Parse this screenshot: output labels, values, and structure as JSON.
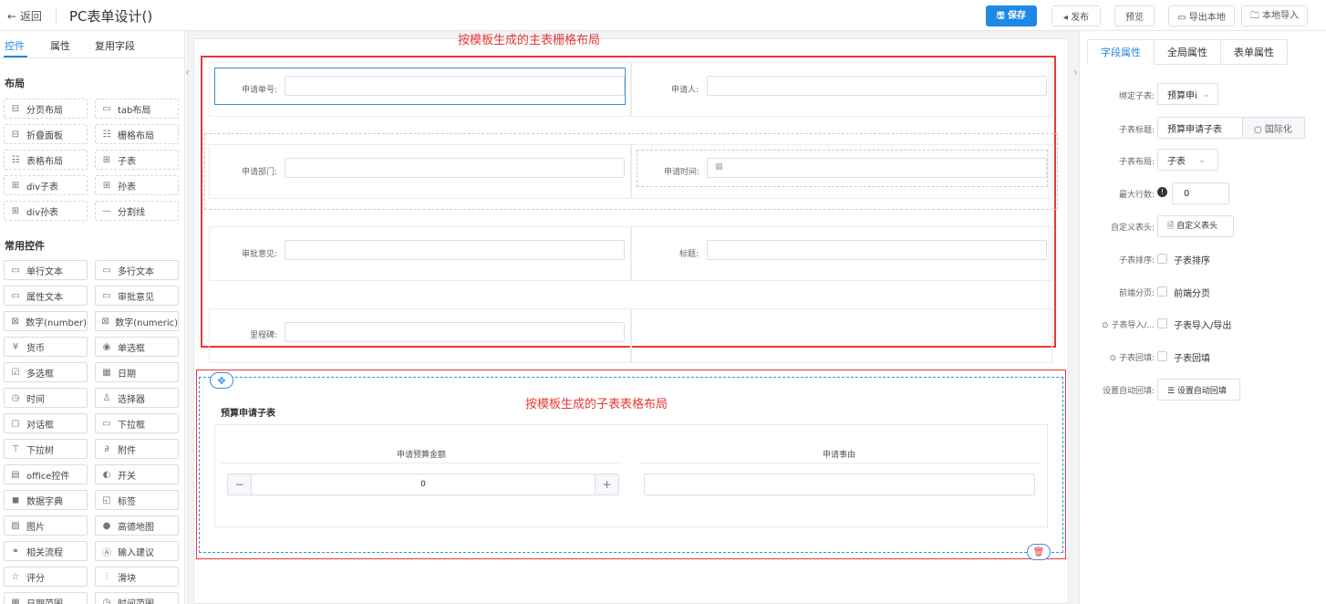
{
  "header": {
    "back_label": "← 返回",
    "title": "PC表单设计()",
    "buttons": {
      "save": "🖫 保存",
      "publish": "◂ 发布",
      "preview": "预览",
      "export": "▭ 导出本地",
      "import": "🗀 本地导入"
    }
  },
  "left_panel": {
    "tabs": [
      "控件",
      "属性",
      "复用字段"
    ],
    "layout_section": "布局",
    "layout_items": [
      {
        "icon": "⊟",
        "label": "分页布局"
      },
      {
        "icon": "▭",
        "label": "tab布局"
      },
      {
        "icon": "⊟",
        "label": "折叠面板"
      },
      {
        "icon": "☷",
        "label": "栅格布局"
      },
      {
        "icon": "☷",
        "label": "表格布局"
      },
      {
        "icon": "⊞",
        "label": "子表"
      },
      {
        "icon": "⊞",
        "label": "div子表"
      },
      {
        "icon": "⊞",
        "label": "孙表"
      },
      {
        "icon": "⊞",
        "label": "div孙表"
      },
      {
        "icon": "—",
        "label": "分割线"
      }
    ],
    "common_section": "常用控件",
    "common_items": [
      {
        "icon": "▭",
        "label": "单行文本"
      },
      {
        "icon": "▭",
        "label": "多行文本"
      },
      {
        "icon": "▭",
        "label": "属性文本"
      },
      {
        "icon": "▭",
        "label": "审批意见"
      },
      {
        "icon": "⊠",
        "label": "数字(number)"
      },
      {
        "icon": "⊠",
        "label": "数字(numeric)"
      },
      {
        "icon": "¥",
        "label": "货币"
      },
      {
        "icon": "◉",
        "label": "单选框"
      },
      {
        "icon": "☑",
        "label": "多选框"
      },
      {
        "icon": "▦",
        "label": "日期"
      },
      {
        "icon": "◷",
        "label": "时间"
      },
      {
        "icon": "♙",
        "label": "选择器"
      },
      {
        "icon": "▢",
        "label": "对话框"
      },
      {
        "icon": "▭",
        "label": "下拉框"
      },
      {
        "icon": "⊤",
        "label": "下拉树"
      },
      {
        "icon": "∂",
        "label": "附件"
      },
      {
        "icon": "▤",
        "label": "office控件"
      },
      {
        "icon": "◐",
        "label": "开关"
      },
      {
        "icon": "◼",
        "label": "数据字典"
      },
      {
        "icon": "◱",
        "label": "标签"
      },
      {
        "icon": "▨",
        "label": "图片"
      },
      {
        "icon": "●",
        "label": "高德地图"
      },
      {
        "icon": "⚭",
        "label": "相关流程"
      },
      {
        "icon": "Ⓐ",
        "label": "输入建议"
      },
      {
        "icon": "☆",
        "label": "评分"
      },
      {
        "icon": "⫶",
        "label": "滑块"
      },
      {
        "icon": "▦",
        "label": "日期范围"
      },
      {
        "icon": "◷",
        "label": "时间范围"
      }
    ]
  },
  "canvas": {
    "annotation_main": "按模板生成的主表栅格布局",
    "annotation_sub": "按模板生成的子表表格布局",
    "fields": [
      {
        "label": "申请单号:"
      },
      {
        "label": "申请人:"
      },
      {
        "label": "申请部门:"
      },
      {
        "label": "申请时间:",
        "icon": "▦"
      },
      {
        "label": "审批意见:"
      },
      {
        "label": "标题:"
      },
      {
        "label": "里程碑:"
      }
    ],
    "subtable": {
      "title": "预算申请子表",
      "columns": [
        "申请预算金额",
        "申请事由"
      ],
      "row": {
        "amount": "0",
        "minus": "−",
        "plus": "+"
      }
    }
  },
  "right_panel": {
    "tabs": [
      "字段属性",
      "全局属性",
      "表单属性"
    ],
    "props": {
      "bind_label": "绑定子表:",
      "bind_value": "预算申i",
      "title_label": "子表标题:",
      "title_value": "预算申请子表",
      "i18n_button": "○ 国际化",
      "layout_label": "子表布局:",
      "layout_value": "子表",
      "maxrows_label": "最大行数:",
      "maxrows_value": "0",
      "header_label": "自定义表头:",
      "header_button": "🗎 自定义表头",
      "sort_label": "子表排序:",
      "sort_text": "子表排序",
      "page_label": "前端分页:",
      "page_text": "前端分页",
      "io_label": "⊙ 子表导入/...",
      "io_text": "子表导入/导出",
      "fill_label": "⊙ 子表回填:",
      "fill_text": "子表回填",
      "autofill_label": "设置自动回填:",
      "autofill_button": "☰ 设置自动回填"
    }
  }
}
